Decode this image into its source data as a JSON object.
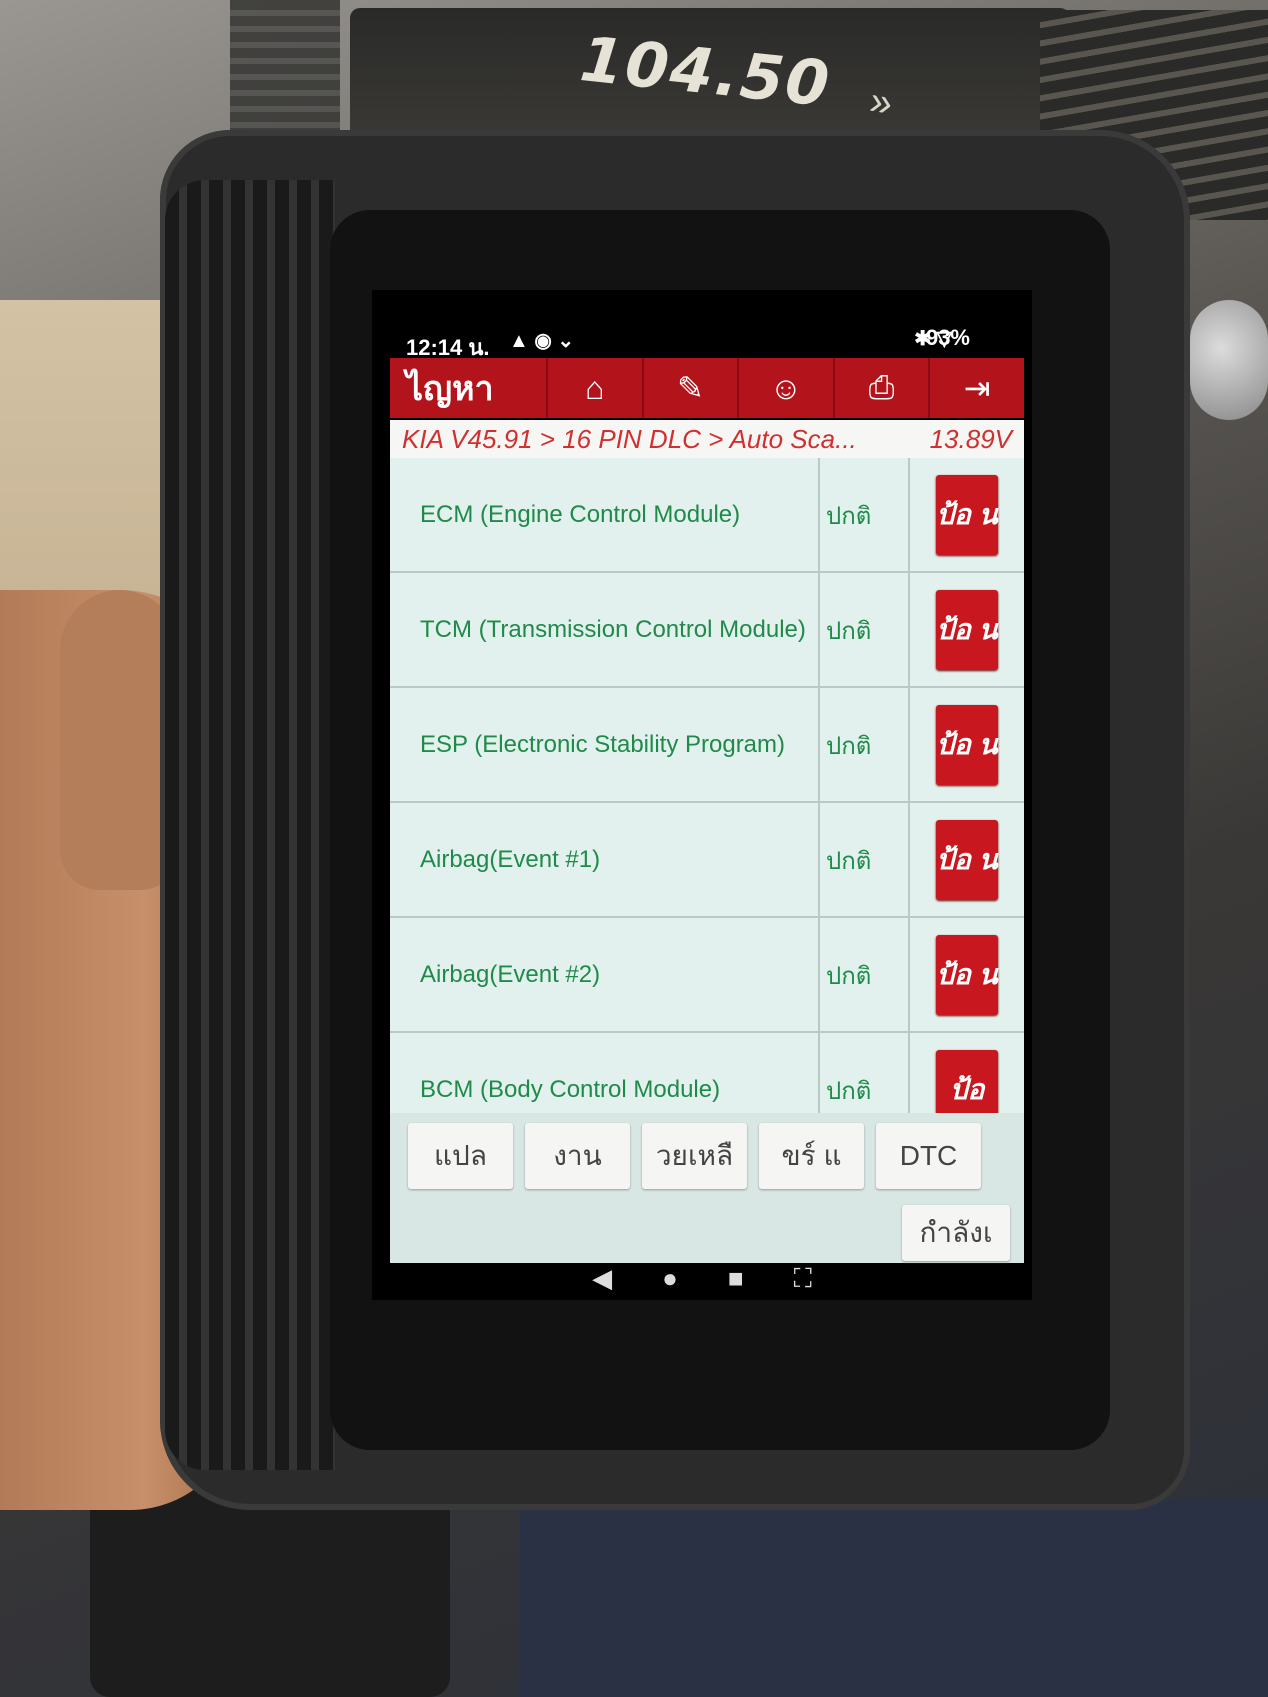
{
  "background": {
    "radio_frequency": "104.50"
  },
  "status_bar": {
    "time": "12:14 น.",
    "battery": "93%"
  },
  "toolbar": {
    "title": "ไญหา",
    "accent_color": "#b3141b",
    "buttons": [
      {
        "icon": "home-icon"
      },
      {
        "icon": "edit-icon"
      },
      {
        "icon": "user-icon"
      },
      {
        "icon": "print-icon"
      },
      {
        "icon": "exit-icon"
      }
    ]
  },
  "breadcrumb": {
    "path": "KIA V45.91 > 16 PIN DLC > Auto Sca...",
    "voltage": "13.89V"
  },
  "modules": [
    {
      "name": "ECM (Engine Control Module)",
      "status": "ปกติ",
      "action": "ป้อ น"
    },
    {
      "name": "TCM (Transmission Control Module)",
      "status": "ปกติ",
      "action": "ป้อ น"
    },
    {
      "name": "ESP (Electronic Stability Program)",
      "status": "ปกติ",
      "action": "ป้อ น"
    },
    {
      "name": "Airbag(Event #1)",
      "status": "ปกติ",
      "action": "ป้อ น"
    },
    {
      "name": "Airbag(Event #2)",
      "status": "ปกติ",
      "action": "ป้อ น"
    },
    {
      "name": "BCM (Body Control Module)",
      "status": "ปกติ",
      "action": "ป้อ"
    }
  ],
  "bottom_buttons": [
    "แปล",
    "งาน",
    "วยเหลื",
    "ขร์ แ",
    "DTC"
  ],
  "wide_button": "กำลังเ"
}
